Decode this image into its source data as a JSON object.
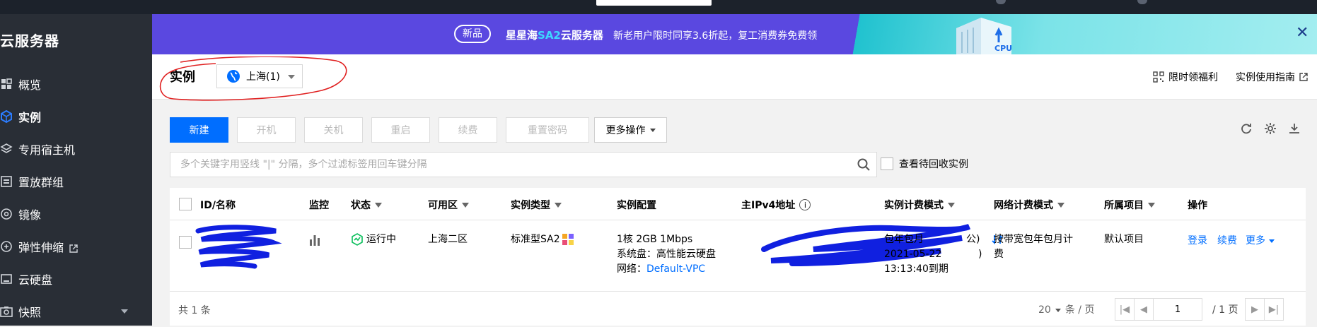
{
  "banner": {
    "badge": "新品",
    "title_prefix": "星星海",
    "title_highlight": "SA2",
    "title_suffix": "云服务器",
    "subtitle": "新老用户限时同享3.6折起，复工消费券免费领",
    "cpu_label": "CPU"
  },
  "sidebar": {
    "product": "云服务器",
    "items": [
      {
        "label": "概览",
        "icon": "grid-icon"
      },
      {
        "label": "实例",
        "icon": "cube-icon"
      },
      {
        "label": "专用宿主机",
        "icon": "layers-icon"
      },
      {
        "label": "置放群组",
        "icon": "group-icon"
      },
      {
        "label": "镜像",
        "icon": "disc-icon"
      },
      {
        "label": "弹性伸缩",
        "icon": "scale-icon"
      },
      {
        "label": "云硬盘",
        "icon": "disk-icon"
      },
      {
        "label": "快照",
        "icon": "camera-icon"
      }
    ]
  },
  "header": {
    "title": "实例",
    "region": "上海(1)",
    "link_benefit": "限时领福利",
    "link_guide": "实例使用指南"
  },
  "toolbar": {
    "new": "新建",
    "start": "开机",
    "stop": "关机",
    "restart": "重启",
    "renew": "续费",
    "reset_password": "重置密码",
    "more": "更多操作"
  },
  "search": {
    "placeholder": "多个关键字用竖线 \"|\" 分隔，多个过滤标签用回车键分隔",
    "recycle_label": "查看待回收实例"
  },
  "table": {
    "columns": {
      "id": "ID/名称",
      "monitor": "监控",
      "status": "状态",
      "zone": "可用区",
      "type": "实例类型",
      "config": "实例配置",
      "ip": "主IPv4地址",
      "billing": "实例计费模式",
      "net_billing": "网络计费模式",
      "project": "所属项目",
      "ops": "操作"
    },
    "row": {
      "status": "运行中",
      "zone": "上海二区",
      "type": "标准型SA2",
      "config_line1": "1核 2GB 1Mbps",
      "config_line2": "系统盘：高性能云硬盘",
      "config_line3_label": "网络：",
      "config_line3_link": "Default-VPC",
      "ip_tail": "公)",
      "ip_tail2": ")",
      "billing_line1": "包年包月",
      "billing_line2": "2021-05-22",
      "billing_line3": "13:13:40到期",
      "net_billing_line1": "按带宽包年包月计",
      "net_billing_line2": "费",
      "project": "默认项目",
      "op_login": "登录",
      "op_renew": "续费",
      "op_more": "更多"
    },
    "footer": {
      "total": "共 1 条",
      "page_size": "20",
      "page_size_unit": "条 / 页",
      "page": "1",
      "page_total": "/ 1 页"
    }
  },
  "colors": {
    "primary": "#006eff",
    "banner": "#5a48e0",
    "sidebar": "#292e36",
    "status_ok": "#0abf5b"
  }
}
